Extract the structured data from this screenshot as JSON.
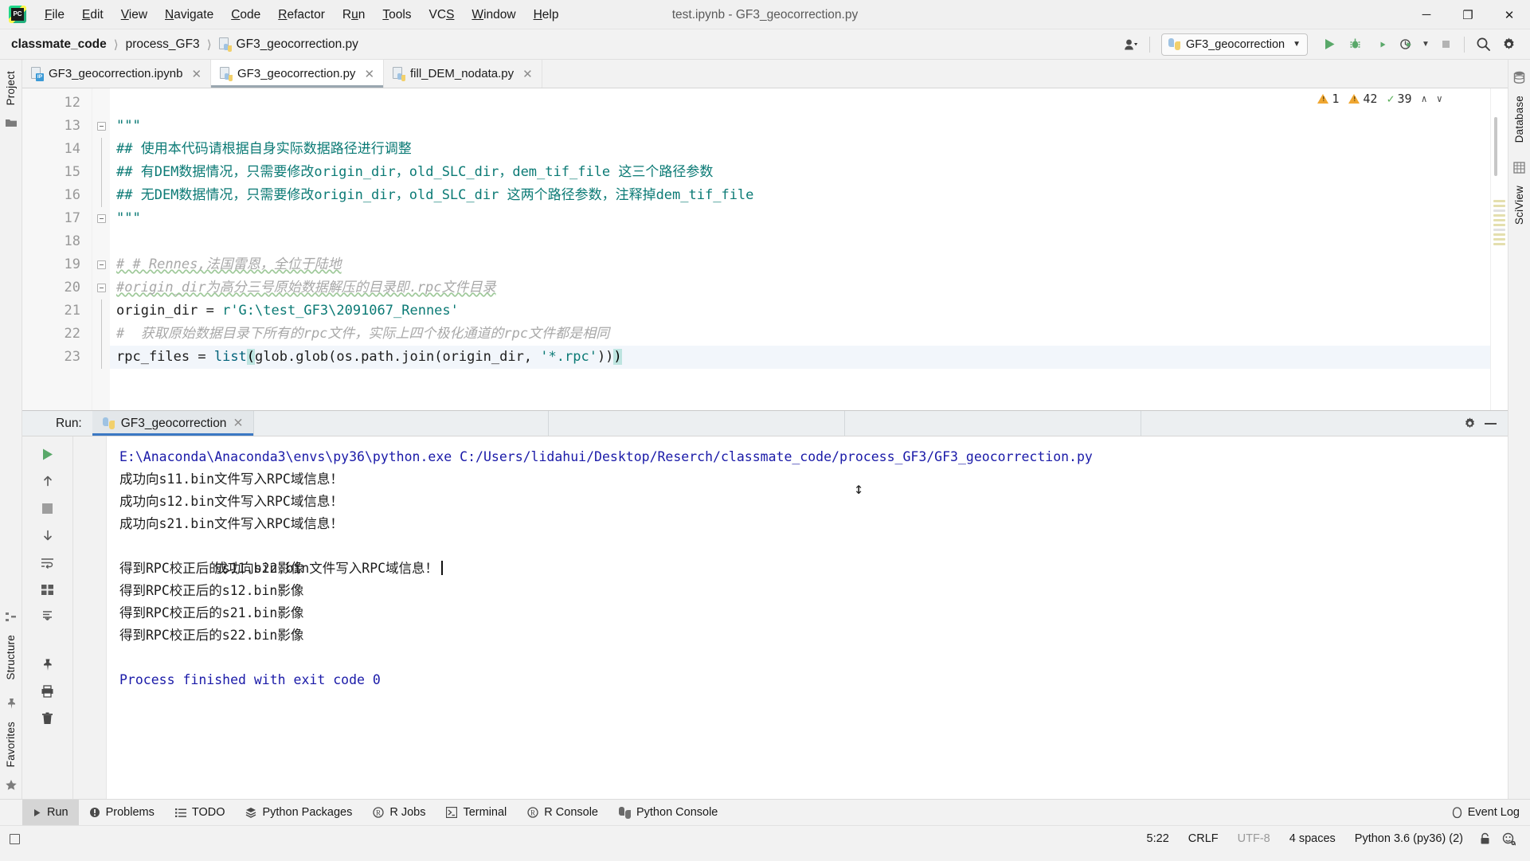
{
  "titlebar": {
    "app_icon": "pycharm-logo-icon",
    "window_title": "test.ipynb - GF3_geocorrection.py",
    "menus": [
      {
        "pre": "",
        "mn": "F",
        "post": "ile"
      },
      {
        "pre": "",
        "mn": "E",
        "post": "dit"
      },
      {
        "pre": "",
        "mn": "V",
        "post": "iew"
      },
      {
        "pre": "",
        "mn": "N",
        "post": "avigate"
      },
      {
        "pre": "",
        "mn": "C",
        "post": "ode"
      },
      {
        "pre": "",
        "mn": "R",
        "post": "efactor"
      },
      {
        "pre": "R",
        "mn": "u",
        "post": "n"
      },
      {
        "pre": "",
        "mn": "T",
        "post": "ools"
      },
      {
        "pre": "VC",
        "mn": "S",
        "post": ""
      },
      {
        "pre": "",
        "mn": "W",
        "post": "indow"
      },
      {
        "pre": "",
        "mn": "H",
        "post": "elp"
      }
    ],
    "minimize": "─",
    "maximize": "❐",
    "close": "✕"
  },
  "navbar": {
    "breadcrumbs": [
      "classmate_code",
      "process_GF3",
      "GF3_geocorrection.py"
    ],
    "separator": "〉",
    "run_config": "GF3_geocorrection",
    "run_config_caret": "▼",
    "icons": {
      "avatar": "user-avatar-icon",
      "avatar_caret": "▼",
      "run": "run-icon",
      "debug": "debug-icon",
      "coverage": "run-with-coverage-icon",
      "profile": "profile-icon",
      "profile_caret": "▼",
      "stop": "stop-icon",
      "search": "search-everywhere-icon",
      "settings": "settings-gear-icon"
    }
  },
  "left_toolbar": {
    "tabs": [
      "Project"
    ],
    "icons": [
      "folder-icon"
    ]
  },
  "right_toolbar": {
    "tabs": [
      "Database",
      "SciView"
    ],
    "icons": [
      "database-icon",
      "sciview-icon"
    ]
  },
  "left_bottom_toolbar": {
    "tabs": [
      "Structure",
      "Favorites"
    ],
    "icons": [
      "structure-icon",
      "star-icon"
    ]
  },
  "editor_tabs": [
    {
      "label": "GF3_geocorrection.ipynb",
      "kind": "ipynb",
      "active": false,
      "close": "✕"
    },
    {
      "label": "GF3_geocorrection.py",
      "kind": "py",
      "active": true,
      "close": "✕"
    },
    {
      "label": "fill_DEM_nodata.py",
      "kind": "py",
      "active": false,
      "close": "✕"
    }
  ],
  "inspection": {
    "warning_count_1": "1",
    "warning_count_2": "42",
    "ok_count": "39",
    "up_caret": "∧",
    "down_caret": "∨"
  },
  "editor": {
    "first_line_number": 12,
    "lines": [
      {
        "n": 12,
        "text": "",
        "fold": "none"
      },
      {
        "n": 13,
        "text": "\"\"\"",
        "fold": "start",
        "cls": "tok-doc"
      },
      {
        "n": 14,
        "text": "## 使用本代码请根据自身实际数据路径进行调整",
        "fold": "line",
        "cls": "tok-doc"
      },
      {
        "n": 15,
        "text": "## 有DEM数据情况，只需要修改origin_dir，old_SLC_dir，dem_tif_file 这三个路径参数",
        "fold": "line",
        "cls": "tok-doc"
      },
      {
        "n": 16,
        "text": "## 无DEM数据情况，只需要修改origin_dir，old_SLC_dir 这两个路径参数，注释掉dem_tif_file",
        "fold": "line",
        "cls": "tok-doc"
      },
      {
        "n": 17,
        "text": "\"\"\"",
        "fold": "end",
        "cls": "tok-doc"
      },
      {
        "n": 18,
        "text": "",
        "fold": "none"
      },
      {
        "n": 19,
        "text": "# # Rennes,法国雷恩，全位于陆地",
        "fold": "start",
        "cls": "tok-cmt"
      },
      {
        "n": 20,
        "text": "#origin_dir为高分三号原始数据解压的目录即.rpc文件目录",
        "fold": "mid",
        "cls": "tok-cmt"
      },
      {
        "n": 21,
        "text": "origin_dir = r'G:\\test_GF3\\2091067_Rennes'",
        "fold": "bar",
        "cls": "code21"
      },
      {
        "n": 22,
        "text": "#  获取原始数据目录下所有的rpc文件，实际上四个极化通道的rpc文件都是相同",
        "fold": "bar",
        "cls": "tok-cmt"
      },
      {
        "n": 23,
        "text": "rpc_files = list(glob.glob(os.path.join(origin_dir, '*.rpc')))",
        "fold": "bar",
        "cls": "code23",
        "highlight": true
      }
    ],
    "code21_parts": [
      {
        "t": "origin_dir ",
        "c": "tok-txt"
      },
      {
        "t": "= ",
        "c": "tok-txt"
      },
      {
        "t": "r'G:\\test_GF3\\2091067_Rennes'",
        "c": "tok-str"
      }
    ],
    "code23_parts": [
      {
        "t": "rpc_files ",
        "c": "tok-txt"
      },
      {
        "t": "= ",
        "c": "tok-txt"
      },
      {
        "t": "list",
        "c": "tok-fn"
      },
      {
        "t": "(",
        "c": "sel"
      },
      {
        "t": "glob.glob(os.path.join(origin_dir, ",
        "c": "tok-txt"
      },
      {
        "t": "'*.rpc'",
        "c": "tok-str"
      },
      {
        "t": "))",
        "c": "tok-txt"
      },
      {
        "t": ")",
        "c": "sel"
      }
    ]
  },
  "run_panel": {
    "label": "Run:",
    "tab_name": "GF3_geocorrection",
    "tab_close": "✕",
    "settings_icon": "settings-gear-icon",
    "minimize_icon": "minimize-icon",
    "side_icons": [
      "rerun-icon",
      "up-arrow-icon",
      "stop-icon",
      "down-arrow-icon",
      "soft-wrap-icon",
      "grid-icon",
      "scroll-to-end-icon",
      "pin-icon",
      "print-icon",
      "trash-icon"
    ],
    "console_lines": [
      {
        "text": "E:\\Anaconda\\Anaconda3\\envs\\py36\\python.exe C:/Users/lidahui/Desktop/Reserch/classmate_code/process_GF3/GF3_geocorrection.py",
        "style": "link"
      },
      {
        "text": "成功向s11.bin文件写入RPC域信息！",
        "style": "plain"
      },
      {
        "text": "成功向s12.bin文件写入RPC域信息！",
        "style": "plain"
      },
      {
        "text": "成功向s21.bin文件写入RPC域信息！",
        "style": "plain"
      },
      {
        "text": "成功向s22.bin文件写入RPC域信息！",
        "style": "caret"
      },
      {
        "text": "得到RPC校正后的s11.bin影像",
        "style": "plain"
      },
      {
        "text": "得到RPC校正后的s12.bin影像",
        "style": "plain"
      },
      {
        "text": "得到RPC校正后的s21.bin影像",
        "style": "plain"
      },
      {
        "text": "得到RPC校正后的s22.bin影像",
        "style": "plain"
      },
      {
        "text": "",
        "style": "plain"
      },
      {
        "text": "Process finished with exit code 0",
        "style": "fin"
      }
    ],
    "cursor_glyph": "↕"
  },
  "bottom_toolwindows": [
    {
      "label": "Run",
      "icon": "run-triangle-icon",
      "active": true
    },
    {
      "label": "Problems",
      "icon": "problems-icon",
      "active": false
    },
    {
      "label": "TODO",
      "icon": "todo-list-icon",
      "active": false
    },
    {
      "label": "Python Packages",
      "icon": "packages-icon",
      "active": false
    },
    {
      "label": "R Jobs",
      "icon": "r-jobs-icon",
      "active": false
    },
    {
      "label": "Terminal",
      "icon": "terminal-icon",
      "active": false
    },
    {
      "label": "R Console",
      "icon": "r-console-icon",
      "active": false
    },
    {
      "label": "Python Console",
      "icon": "python-console-icon",
      "active": false
    }
  ],
  "event_log": {
    "label": "Event Log",
    "icon": "event-log-icon"
  },
  "statusbar": {
    "caret_position": "5:22",
    "line_separator": "CRLF",
    "encoding": "UTF-8",
    "indent": "4 spaces",
    "interpreter": "Python 3.6 (py36) (2)",
    "lock_icon": "lock-icon",
    "inspection_icon": "inspection-face-icon"
  },
  "colors": {
    "accent_blue": "#3b78c3",
    "console_link": "#1a1aa8",
    "docstring_teal": "#0b7a75",
    "comment_gray": "#a8a8a8",
    "warning_orange": "#f0a732",
    "ok_green": "#5aaf5a",
    "chrome_bg": "#f2f2f2"
  }
}
